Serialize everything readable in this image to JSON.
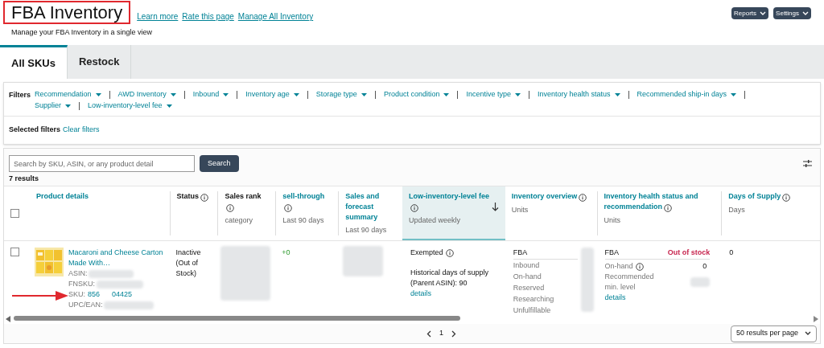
{
  "header": {
    "title": "FBA Inventory",
    "links": [
      "Learn more",
      "Rate this page",
      "Manage All Inventory"
    ],
    "subtitle": "Manage your FBA Inventory in a single view",
    "buttons": [
      "Reports",
      "Settings"
    ]
  },
  "tabs": [
    {
      "label": "All SKUs",
      "selected": true
    },
    {
      "label": "Restock",
      "selected": false
    }
  ],
  "filters": {
    "label": "Filters",
    "items": [
      "Recommendation",
      "AWD Inventory",
      "Inbound",
      "Inventory age",
      "Storage type",
      "Product condition",
      "Incentive type",
      "Inventory health status",
      "Recommended ship-in days",
      "Supplier",
      "Low-inventory-level fee"
    ],
    "selected_label": "Selected filters",
    "clear": "Clear filters"
  },
  "search": {
    "placeholder": "Search by SKU, ASIN, or any product detail",
    "button": "Search",
    "results": "7 results"
  },
  "table": {
    "select_all_checked": false,
    "columns": [
      {
        "kind": "link",
        "title": "Product details",
        "info": false,
        "sorted": false
      },
      {
        "kind": "plain",
        "title": "Status",
        "info": true,
        "sorted": false
      },
      {
        "kind": "plain",
        "title": "Sales rank",
        "info": true,
        "subtitle": "category",
        "sorted": false
      },
      {
        "kind": "link",
        "title": "sell-through",
        "info": true,
        "subtitle": "Last 90 days",
        "sorted": false
      },
      {
        "kind": "link",
        "title": "Sales and forecast summary",
        "info": false,
        "subtitle": "Last 90 days",
        "sorted": false
      },
      {
        "kind": "link",
        "title": "Low-inventory-level fee",
        "info": true,
        "subtitle": "Updated weekly",
        "sorted": true
      },
      {
        "kind": "link",
        "title": "Inventory overview",
        "info": true,
        "subtitle": "Units",
        "sorted": false
      },
      {
        "kind": "link",
        "title": "Inventory health status and recommendation",
        "info": true,
        "subtitle": "Units",
        "sorted": false
      },
      {
        "kind": "link",
        "title": "Days of Supply",
        "info": true,
        "subtitle": "Days",
        "sorted": false
      }
    ],
    "row": {
      "checked": false,
      "product": {
        "title": "Macaroni and Cheese Carton Made With…",
        "asin": "ASIN:",
        "fnsku": "FNSKU:",
        "sku_label": "SKU:",
        "sku": "856      04425",
        "upc": "UPC/EAN:"
      },
      "status": "Inactive (Out of Stock)",
      "sell_through": "+0",
      "fee": {
        "status": "Exempted",
        "history": "Historical days of supply (Parent ASIN): 90",
        "link": "details"
      },
      "overview": {
        "heading": "FBA",
        "labels": [
          "Inbound",
          "On-hand",
          "Reserved",
          "Researching",
          "Unfulfillable"
        ]
      },
      "health": {
        "heading": "FBA",
        "status": "Out of stock",
        "on_hand_label": "On-hand",
        "on_hand": "0",
        "min_label": "Recommended min. level",
        "link": "details"
      },
      "days": "0"
    }
  },
  "pagination": {
    "page": "1",
    "per_page": "50 results per page"
  }
}
